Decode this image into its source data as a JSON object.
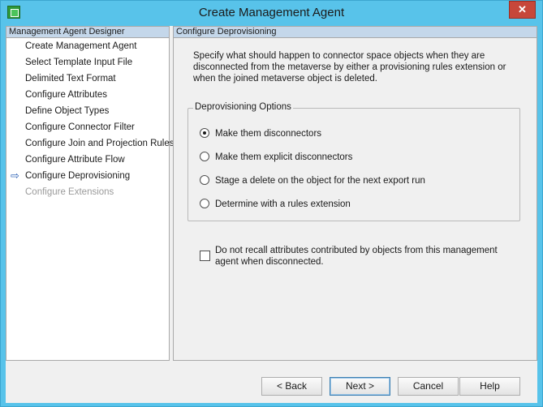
{
  "window": {
    "title": "Create Management Agent",
    "close_glyph": "✕"
  },
  "sidebar": {
    "header": "Management Agent Designer",
    "items": [
      {
        "label": "Create Management Agent",
        "state": "done"
      },
      {
        "label": "Select Template Input File",
        "state": "done"
      },
      {
        "label": "Delimited Text Format",
        "state": "done"
      },
      {
        "label": "Configure Attributes",
        "state": "done"
      },
      {
        "label": "Define Object Types",
        "state": "done"
      },
      {
        "label": "Configure Connector Filter",
        "state": "done"
      },
      {
        "label": "Configure Join and Projection Rules",
        "state": "done"
      },
      {
        "label": "Configure Attribute Flow",
        "state": "done"
      },
      {
        "label": "Configure Deprovisioning",
        "state": "current"
      },
      {
        "label": "Configure Extensions",
        "state": "disabled"
      }
    ],
    "current_marker": "⇨"
  },
  "main": {
    "header": "Configure Deprovisioning",
    "description": "Specify what should happen to connector space objects when they are disconnected from the metaverse by either a provisioning rules extension or when the joined metaverse object is deleted.",
    "group_label": "Deprovisioning Options",
    "options": [
      {
        "label": "Make them disconnectors",
        "selected": true
      },
      {
        "label": "Make them explicit disconnectors",
        "selected": false
      },
      {
        "label": "Stage a delete on the object for the next export run",
        "selected": false
      },
      {
        "label": "Determine with a rules extension",
        "selected": false
      }
    ],
    "checkbox_label": "Do not recall attributes contributed by objects from this management agent when disconnected.",
    "checkbox_checked": false
  },
  "footer": {
    "back": "< Back",
    "next": "Next >",
    "cancel": "Cancel",
    "help": "Help"
  },
  "colors": {
    "titlebar": "#58c3ea",
    "close_button": "#c7473a",
    "panel_header": "#c4d7ea"
  }
}
